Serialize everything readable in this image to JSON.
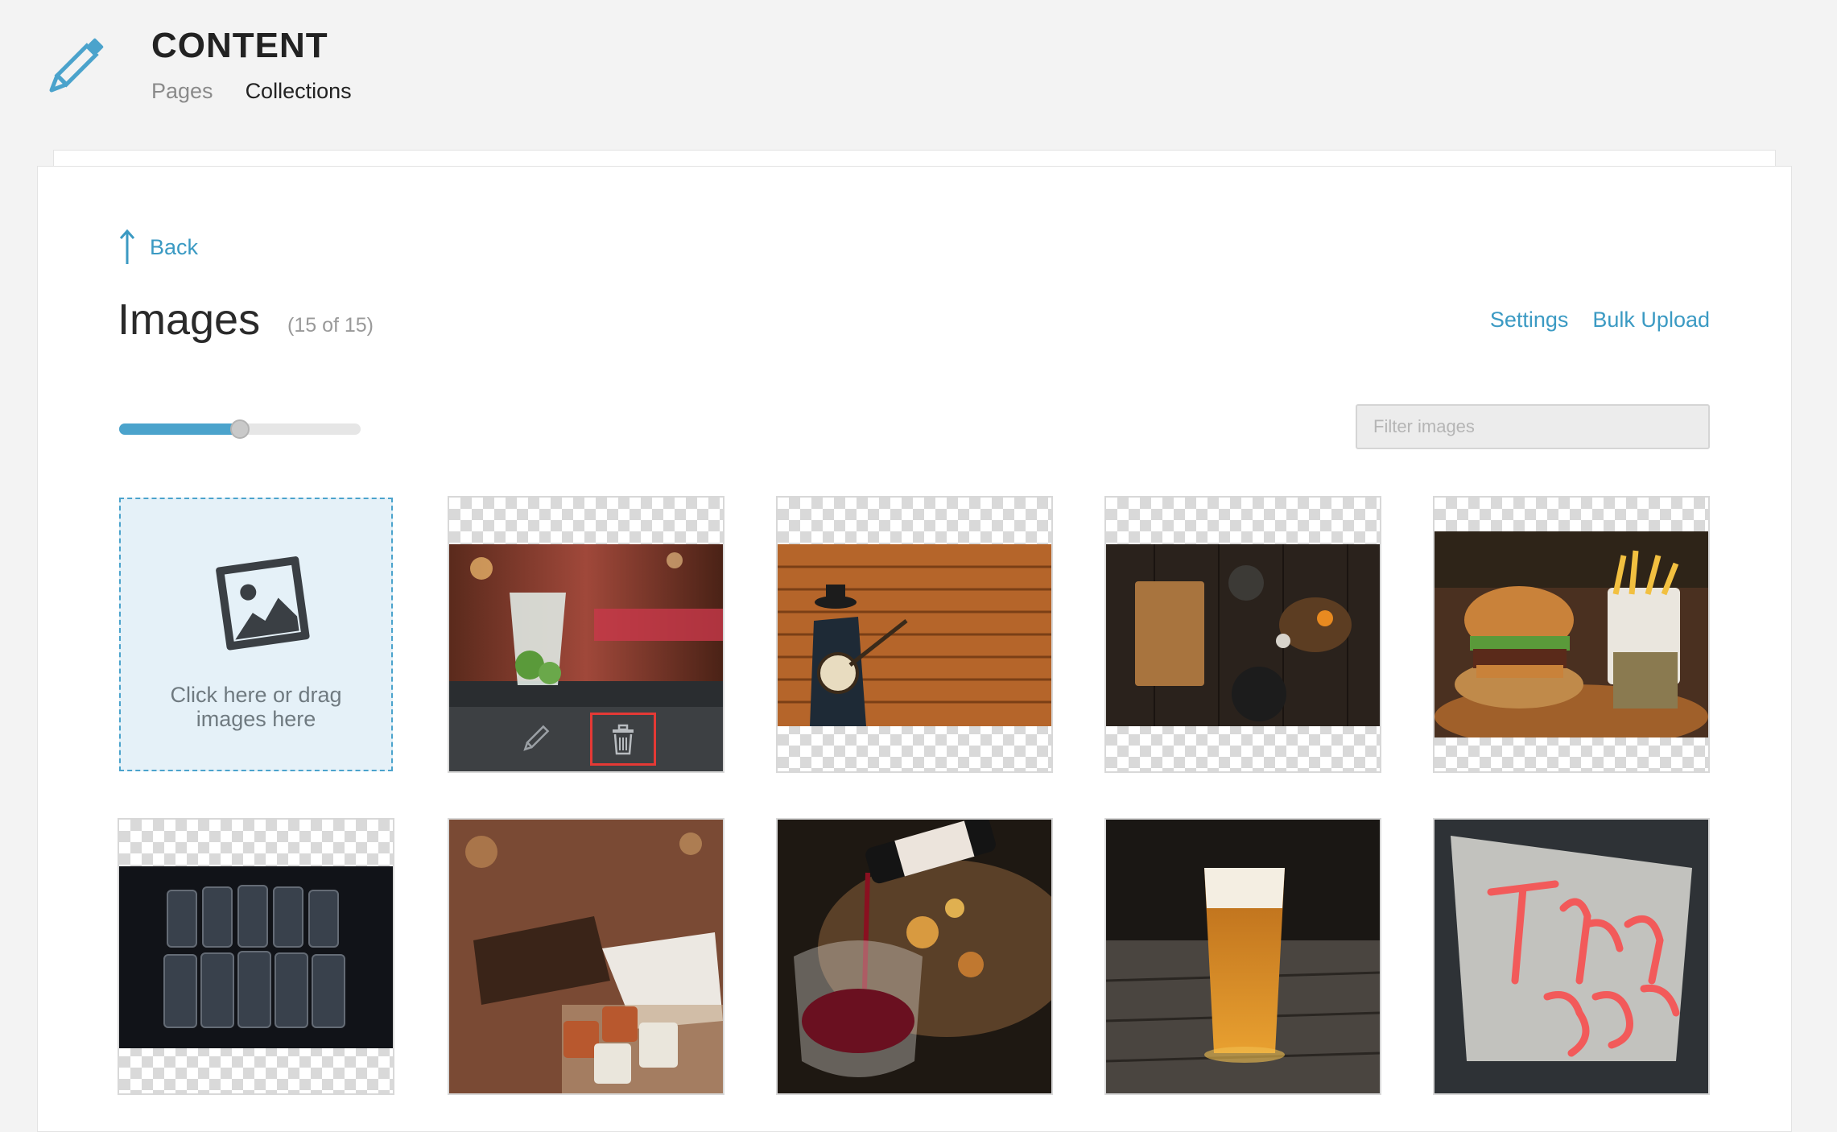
{
  "header": {
    "title": "CONTENT",
    "icon": "pencil-icon",
    "tabs": [
      {
        "label": "Pages",
        "active": false
      },
      {
        "label": "Collections",
        "active": true
      }
    ]
  },
  "nav": {
    "back_label": "Back",
    "back_icon": "arrow-up-icon"
  },
  "page": {
    "title": "Images",
    "count": "(15 of 15)",
    "actions": {
      "settings_label": "Settings",
      "bulk_upload_label": "Bulk Upload"
    }
  },
  "toolbar": {
    "size_slider_value": 0.5,
    "filter_placeholder": "Filter images",
    "filter_value": ""
  },
  "upload": {
    "label": "Click here or drag images here",
    "icon": "image-upload-icon"
  },
  "tile_actions": {
    "edit_icon": "pencil-icon",
    "delete_icon": "trash-icon"
  },
  "images": [
    {
      "name": "mojito-cocktail",
      "subject": "cocktail"
    },
    {
      "name": "banjo-player",
      "subject": "banjo"
    },
    {
      "name": "kitchen-tabletop",
      "subject": "kitchen"
    },
    {
      "name": "burger-and-fries",
      "subject": "burger"
    },
    {
      "name": "stacked-glasses",
      "subject": "glasses"
    },
    {
      "name": "copper-mugs",
      "subject": "mugs"
    },
    {
      "name": "wine-pour",
      "subject": "wine"
    },
    {
      "name": "beer-pint",
      "subject": "beer"
    },
    {
      "name": "neon-thank-you",
      "subject": "neon"
    }
  ],
  "colors": {
    "accent": "#3b9ac3",
    "upload_bg": "#e5f1f8",
    "toolbar_bg": "#3d4043",
    "highlight": "#e53935"
  }
}
